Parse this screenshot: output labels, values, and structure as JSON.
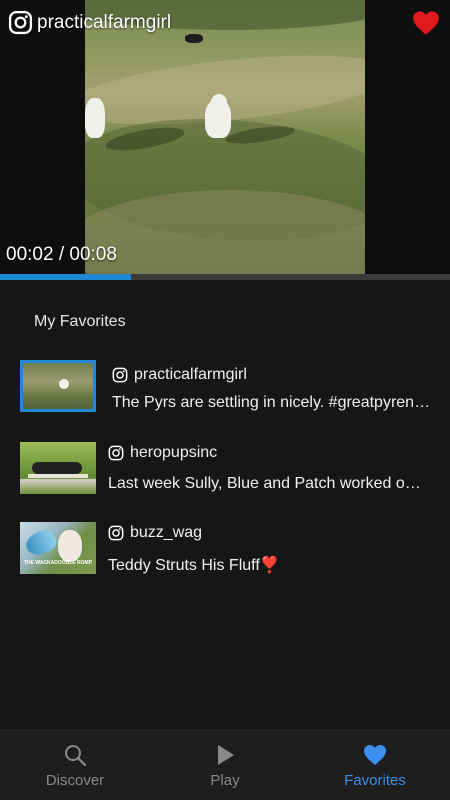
{
  "player": {
    "account_handle": "practicalfarmgirl",
    "timecode": "00:02 / 00:08",
    "progress_fraction": 0.29,
    "favorited": true,
    "icons": {
      "account": "instagram-icon",
      "favorite": "heart-icon"
    }
  },
  "favorites": {
    "title": "My Favorites",
    "items": [
      {
        "username": "practicalfarmgirl",
        "caption": "The Pyrs are settling in nicely. #greatpyrenees",
        "selected": true
      },
      {
        "username": "heropupsinc",
        "caption": "Last week Sully, Blue and Patch worked on their leash skills",
        "selected": false
      },
      {
        "username": "buzz_wag",
        "caption": "Teddy Struts His Fluff",
        "caption_emoji": "❣️",
        "thumb_text": "THE WACKADOODLE ROMP",
        "selected": false
      }
    ]
  },
  "nav": {
    "items": [
      {
        "label": "Discover",
        "icon": "search-icon",
        "active": false
      },
      {
        "label": "Play",
        "icon": "play-icon",
        "active": false
      },
      {
        "label": "Favorites",
        "icon": "heart-icon",
        "active": true
      }
    ]
  },
  "colors": {
    "accent": "#1e88d6",
    "favorite_red": "#e0191c",
    "active_nav": "#3b8ff0"
  }
}
